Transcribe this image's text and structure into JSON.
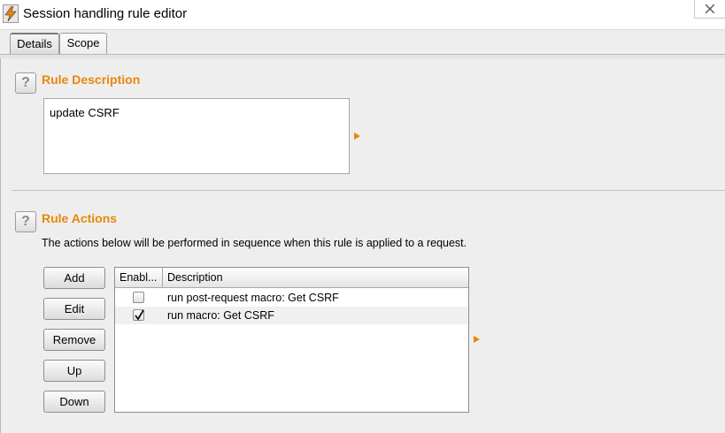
{
  "window": {
    "title": "Session handling rule editor"
  },
  "tabs": [
    {
      "label": "Details",
      "active": true
    },
    {
      "label": "Scope",
      "active": false
    }
  ],
  "rule_description": {
    "heading": "Rule Description",
    "value": "update CSRF"
  },
  "rule_actions": {
    "heading": "Rule Actions",
    "info": "The actions below will be performed in sequence when this rule is applied to a request.",
    "buttons": {
      "add": "Add",
      "edit": "Edit",
      "remove": "Remove",
      "up": "Up",
      "down": "Down"
    },
    "table": {
      "columns": [
        "Enabl...",
        "Description"
      ],
      "rows": [
        {
          "enabled": false,
          "description": "run post-request macro: Get CSRF"
        },
        {
          "enabled": true,
          "description": "run macro: Get CSRF"
        }
      ]
    }
  },
  "icons": {
    "app": "burp-lightning-icon",
    "help": "question-mark-icon",
    "expand": "orange-triangle-icon",
    "close": "close-icon"
  },
  "colors": {
    "accent": "#e8870a",
    "panel_bg": "#eeeeee",
    "selected_row": "#f0f0f0"
  }
}
